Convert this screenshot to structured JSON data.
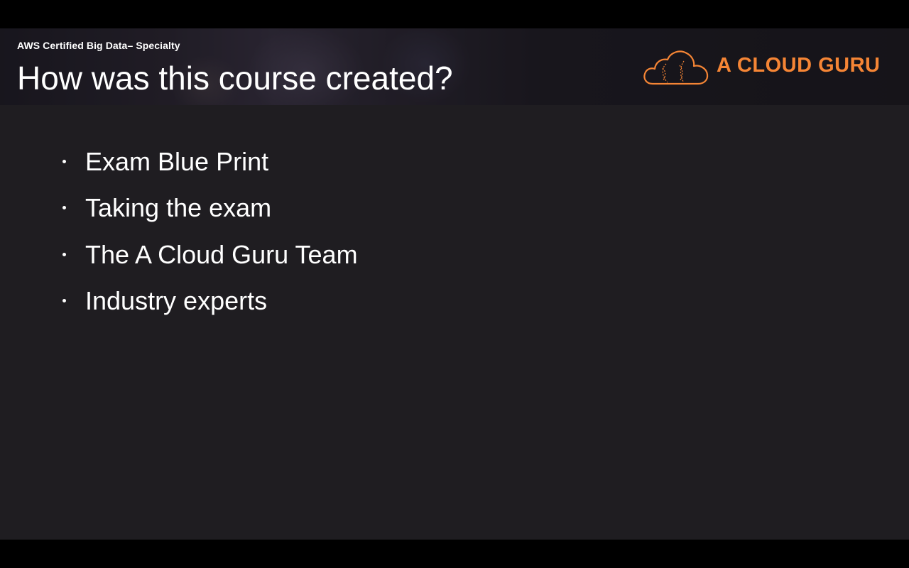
{
  "header": {
    "course_label": "AWS Certified Big Data– Specialty",
    "title": "How was this course created?"
  },
  "logo": {
    "text": "A CLOUD GURU",
    "icon": "cloud-icon",
    "brand_color": "#f58535"
  },
  "bullets": [
    {
      "label": "Exam Blue Print"
    },
    {
      "label": "Taking the exam"
    },
    {
      "label": "The A Cloud Guru Team"
    },
    {
      "label": "Industry experts"
    }
  ],
  "colors": {
    "slide_background": "#1f1d21",
    "text": "#ffffff",
    "letterbox": "#000000"
  }
}
